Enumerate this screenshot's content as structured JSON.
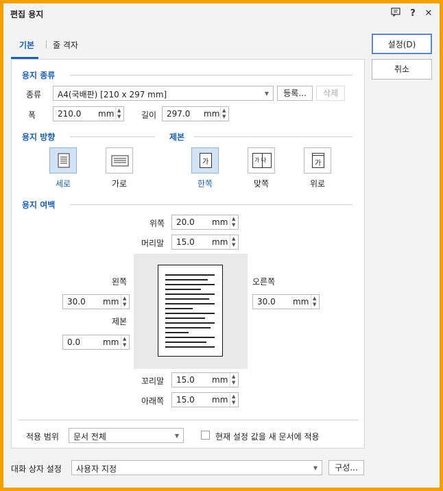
{
  "window": {
    "title": "편집 용지"
  },
  "tabs": [
    {
      "label": "기본"
    },
    {
      "label": "줄 격자"
    }
  ],
  "actions": {
    "ok_label": "설정(D)",
    "cancel_label": "취소"
  },
  "paper_type": {
    "section_title": "용지 종류",
    "kind_label": "종류",
    "kind_value": "A4(국배판) [210 x 297 mm]",
    "register_label": "등록...",
    "delete_label": "삭제",
    "width_label": "폭",
    "width_value": "210.0",
    "height_label": "길이",
    "height_value": "297.0",
    "unit": "mm"
  },
  "orientation": {
    "section_title": "용지 방향",
    "portrait_label": "세로",
    "landscape_label": "가로",
    "selected": "portrait"
  },
  "binding": {
    "section_title": "제본",
    "single_label": "한쪽",
    "facing_label": "맞쪽",
    "top_label": "위로",
    "selected": "single",
    "icon_text_single": "가",
    "icon_text_facing": "가 나",
    "icon_text_top": "가"
  },
  "margins": {
    "section_title": "용지 여백",
    "top_label": "위쪽",
    "top_value": "20.0",
    "header_label": "머리말",
    "header_value": "15.0",
    "left_label": "왼쪽",
    "left_value": "30.0",
    "right_label": "오른쪽",
    "right_value": "30.0",
    "binding_label": "제본",
    "binding_value": "0.0",
    "footer_label": "꼬리말",
    "footer_value": "15.0",
    "bottom_label": "아래쪽",
    "bottom_value": "15.0",
    "unit": "mm"
  },
  "apply": {
    "label": "적용 범위",
    "value": "문서 전체",
    "default_checkbox_label": "현재 설정 값을 새 문서에 적용",
    "default_checked": false
  },
  "dialog_settings": {
    "label": "대화 상자 설정",
    "value": "사용자 지정",
    "configure_label": "구성..."
  },
  "colors": {
    "accent": "#1b5fb4",
    "frame": "#f5a000",
    "selected_bg": "#d3e3f6"
  }
}
